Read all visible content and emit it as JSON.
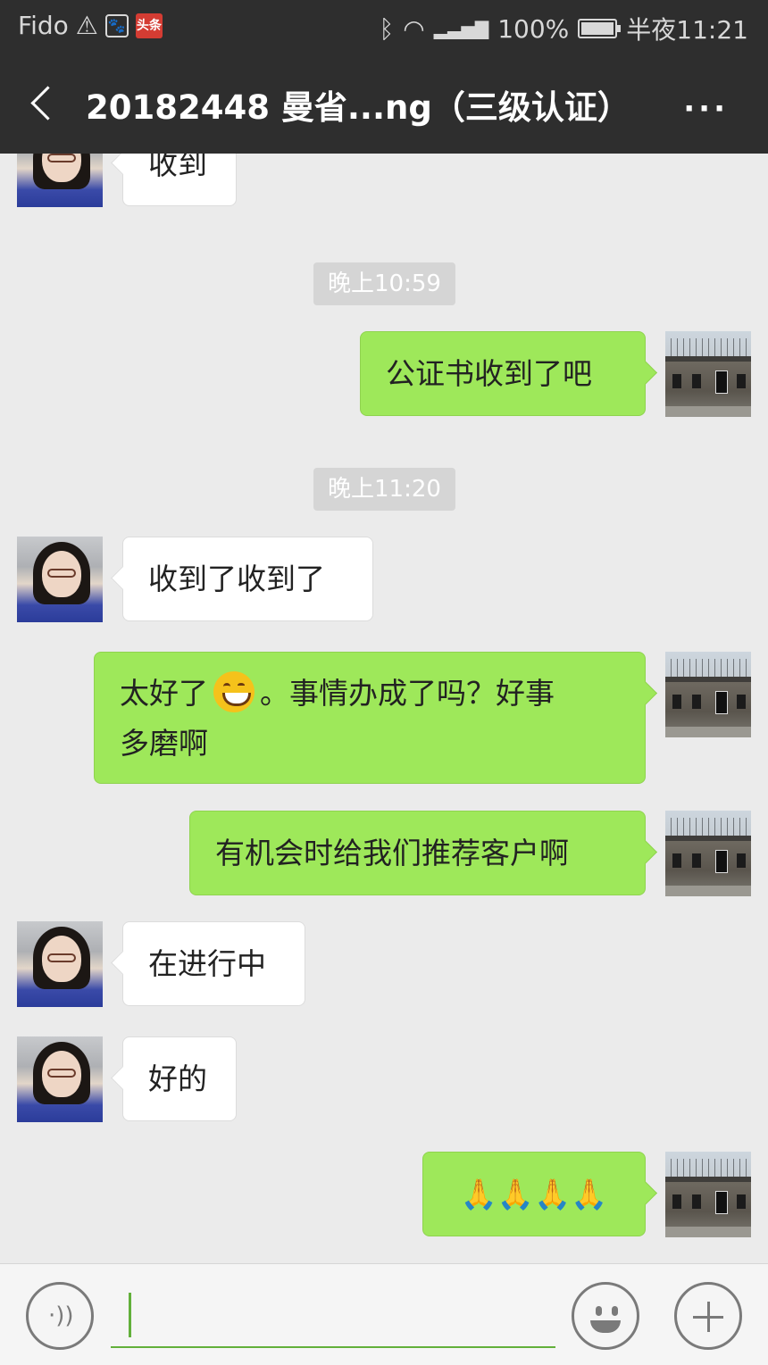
{
  "status": {
    "carrier": "Fido",
    "battery": "100%",
    "battery_level": 1.0,
    "time": "半夜11:21",
    "icons": [
      "warning-icon",
      "paw-icon",
      "toutiao-icon",
      "bluetooth-icon",
      "wifi-icon",
      "4g-icon",
      "signal-icon",
      "battery-icon"
    ],
    "toutiao_label": "头条"
  },
  "header": {
    "title": "20182448 曼省...ng（三级认证）",
    "more": "···"
  },
  "messages": [
    {
      "side": "left",
      "text": "收到"
    },
    {
      "time": "晚上10:59"
    },
    {
      "side": "right",
      "text": "公证书收到了吧"
    },
    {
      "time": "晚上11:20"
    },
    {
      "side": "left",
      "text": "收到了收到了"
    },
    {
      "side": "right",
      "text_a": "太好了",
      "emoji": "grinning-face",
      "text_b": "。事情办成了吗？好事",
      "text_c": "多磨啊"
    },
    {
      "side": "right",
      "text": "有机会时给我们推荐客户啊"
    },
    {
      "side": "left",
      "text": "在进行中"
    },
    {
      "side": "left",
      "text": "好的"
    },
    {
      "side": "right",
      "text": "🙏🙏🙏🙏"
    }
  ],
  "input_bar": {
    "voice": "voice-icon",
    "emoji": "emoji-icon",
    "plus": "plus-icon",
    "value": ""
  }
}
